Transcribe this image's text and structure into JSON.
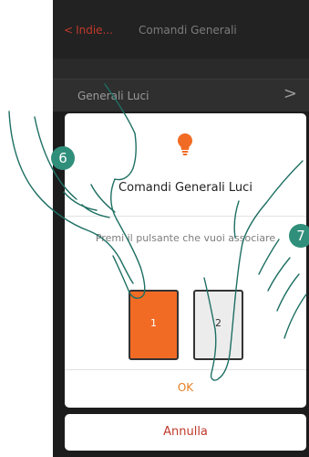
{
  "header": {
    "back_label": "Indie...",
    "title": "Comandi Generali"
  },
  "list": {
    "item_label": "Generali Luci"
  },
  "dialog": {
    "title": "Comandi Generali Luci",
    "message": "Premi il pulsante che vuoi associare",
    "buttons": [
      {
        "label": "1",
        "selected": true
      },
      {
        "label": "2",
        "selected": false
      }
    ],
    "ok_label": "OK"
  },
  "cancel_label": "Annulla",
  "callouts": [
    "6",
    "7"
  ],
  "colors": {
    "accent_orange": "#f26b24",
    "ok_orange": "#e67e22",
    "cancel_red": "#c0392b",
    "badge_teal": "#2f8f7b"
  },
  "icons": {
    "dialog_icon": "lightbulb-icon",
    "back_icon": "chevron-left-icon",
    "list_icon": "chevron-right-icon"
  }
}
